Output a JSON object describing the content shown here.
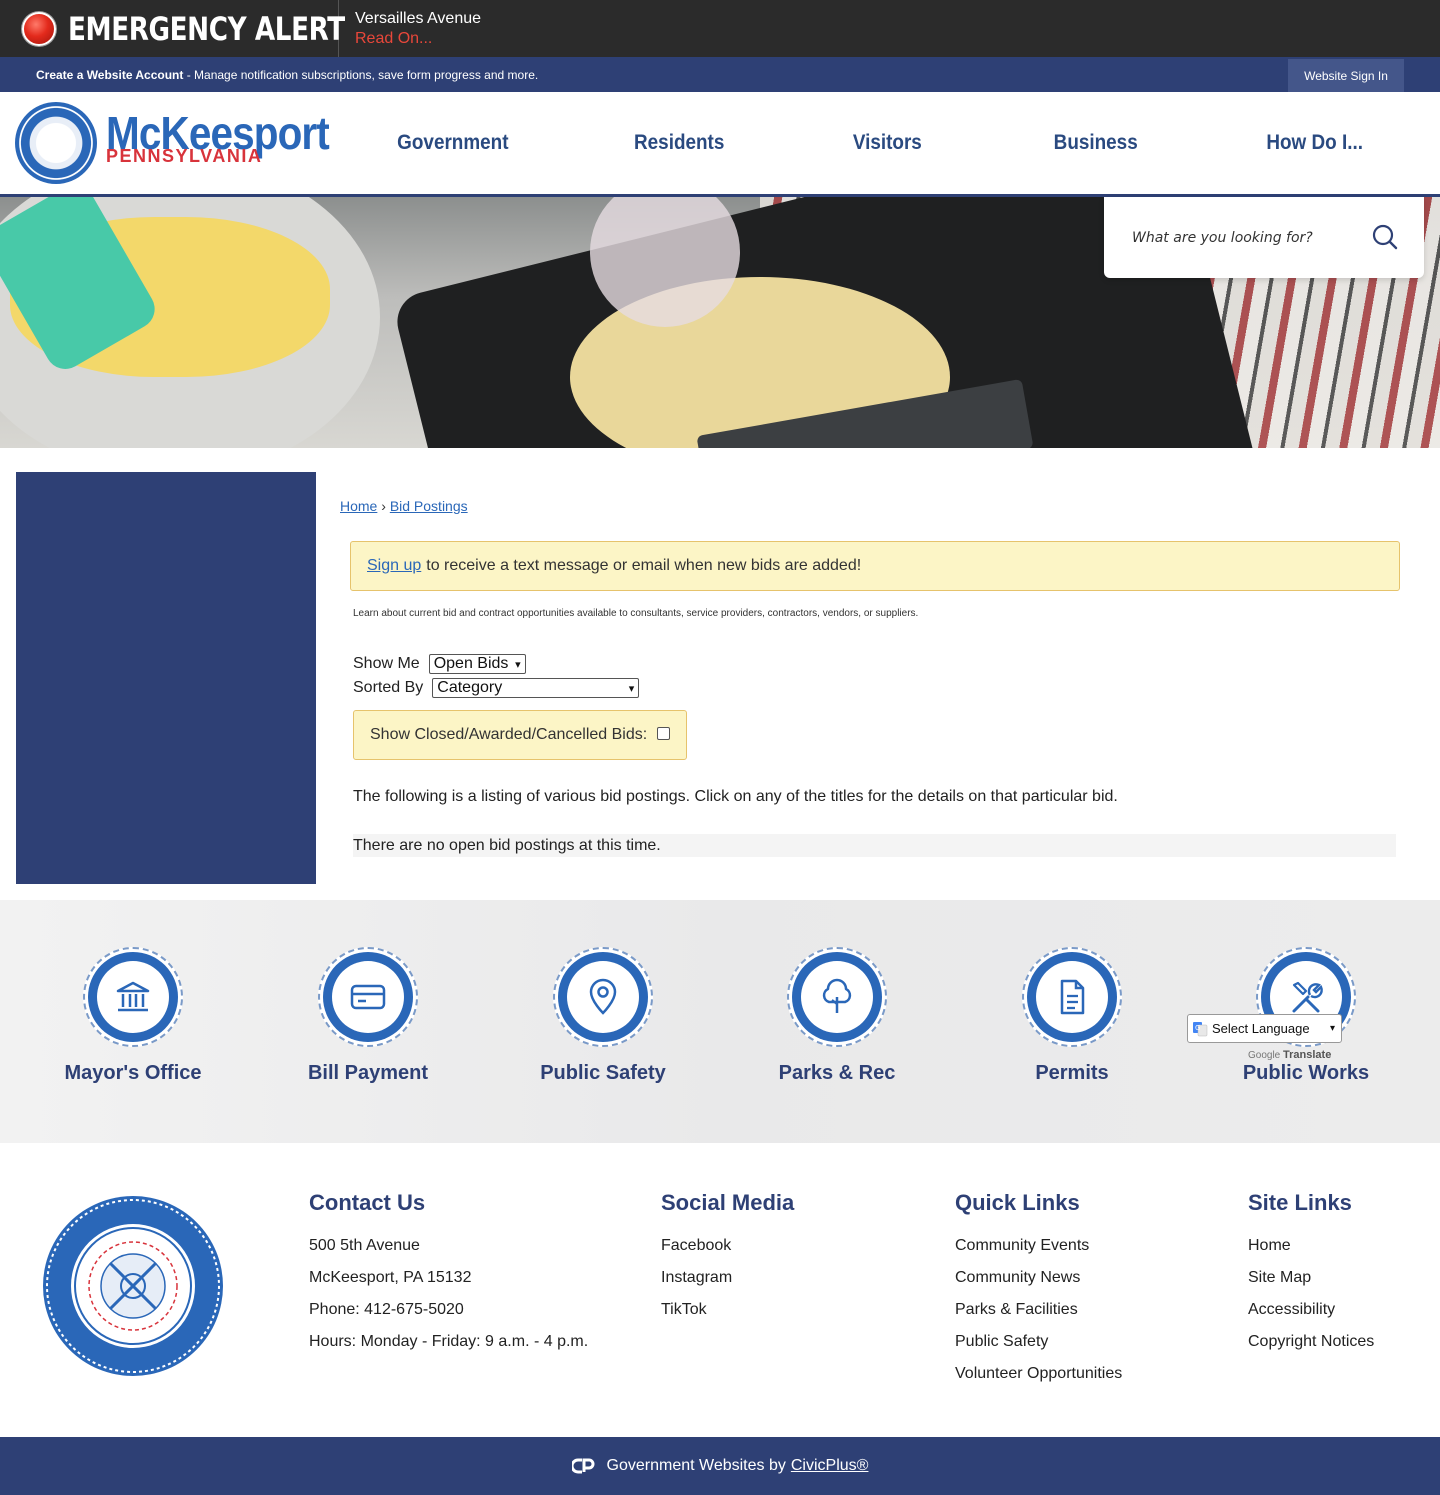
{
  "alert": {
    "title": "EMERGENCY ALERT",
    "item_title": "Versailles Avenue",
    "read_on": "Read On..."
  },
  "account_bar": {
    "create_label": "Create a Website Account",
    "create_text": " - Manage notification subscriptions, save form progress and more.",
    "sign_in": "Website Sign In"
  },
  "logo": {
    "name": "McKeesport",
    "state": "PENNSYLVANIA"
  },
  "nav": [
    "Government",
    "Residents",
    "Visitors",
    "Business",
    "How Do I..."
  ],
  "search": {
    "placeholder": "What are you looking for?"
  },
  "breadcrumb": {
    "home": "Home",
    "separator": "›",
    "current": "Bid Postings"
  },
  "notice": {
    "link": "Sign up",
    "text": "to receive a text message or email when new bids are added!"
  },
  "description": "Learn about current bid and contract opportunities available to consultants, service providers, contractors, vendors, or suppliers.",
  "filters": {
    "show_me_label": "Show Me",
    "show_me_value": "Open Bids",
    "sorted_by_label": "Sorted By",
    "sorted_by_value": "Category",
    "closed_label": "Show Closed/Awarded/Cancelled Bids:"
  },
  "listing_text": "The following is a listing of various bid postings. Click on any of the titles for the details on that particular bid.",
  "empty_text": "There are no open bid postings at this time.",
  "quick_links": [
    {
      "label": "Mayor's Office",
      "icon": "building-icon"
    },
    {
      "label": "Bill Payment",
      "icon": "card-icon"
    },
    {
      "label": "Public Safety",
      "icon": "location-pin-icon"
    },
    {
      "label": "Parks & Rec",
      "icon": "tree-icon"
    },
    {
      "label": "Permits",
      "icon": "document-icon"
    },
    {
      "label": "Public Works",
      "icon": "tools-icon"
    }
  ],
  "translate": {
    "select_label": "Select Language",
    "powered_by": "Google",
    "translate_label": "Translate"
  },
  "footer": {
    "contact": {
      "heading": "Contact Us",
      "items": [
        "500 5th Avenue",
        "McKeesport, PA 15132",
        "Phone: 412-675-5020",
        "Hours: Monday - Friday: 9 a.m. - 4 p.m."
      ]
    },
    "social": {
      "heading": "Social Media",
      "items": [
        "Facebook",
        "Instagram",
        "TikTok"
      ]
    },
    "quick": {
      "heading": "Quick Links",
      "items": [
        "Community Events",
        "Community News",
        "Parks & Facilities",
        "Public Safety",
        "Volunteer Opportunities"
      ]
    },
    "site": {
      "heading": "Site Links",
      "items": [
        "Home",
        "Site Map",
        "Accessibility",
        "Copyright Notices"
      ]
    }
  },
  "bottom_bar": {
    "text": "Government Websites by",
    "link": "CivicPlus®"
  },
  "colors": {
    "navy": "#2e4075",
    "blue": "#2a67b8",
    "red": "#d8333b",
    "alert_bg": "#2b2b2b",
    "notice_bg": "#fcf5c6"
  }
}
